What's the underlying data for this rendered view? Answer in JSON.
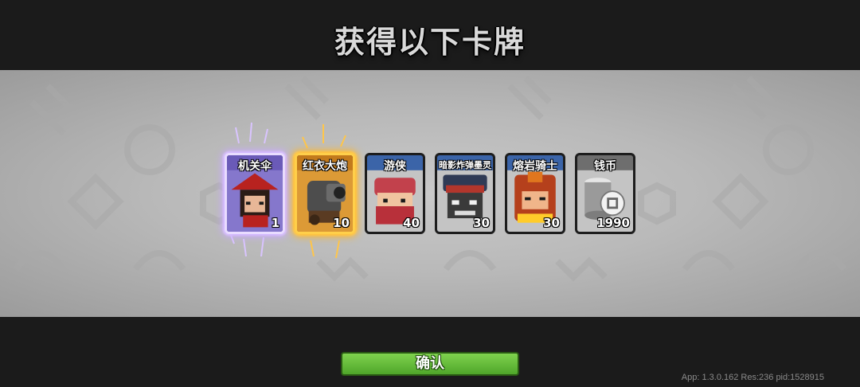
{
  "title": "获得以下卡牌",
  "cards": [
    {
      "name": "机关伞",
      "count": "1",
      "rarity_color": "#c9a8ff",
      "frame_color": "#6a5ab8"
    },
    {
      "name": "红衣大炮",
      "count": "10",
      "rarity_color": "#ffb526",
      "frame_color": "#c27a1c"
    },
    {
      "name": "游侠",
      "count": "40",
      "rarity_color": "#4f7fc4",
      "frame_color": "#3b64a8"
    },
    {
      "name": "暗影炸弹墨灵",
      "count": "30",
      "rarity_color": "#4f7fc4",
      "frame_color": "#3b64a8"
    },
    {
      "name": "熔岩骑士",
      "count": "30",
      "rarity_color": "#4f7fc4",
      "frame_color": "#3b64a8"
    },
    {
      "name": "钱币",
      "count": "1990",
      "rarity_color": "#8a8a8a",
      "frame_color": "#6e6e6e"
    }
  ],
  "confirm_label": "确认",
  "version_text": "App: 1.3.0.162 Res:236 pid:1528915",
  "colors": {
    "band": "#bdbdbd",
    "background": "#1b1b1b",
    "confirm": "#5fb83a"
  }
}
